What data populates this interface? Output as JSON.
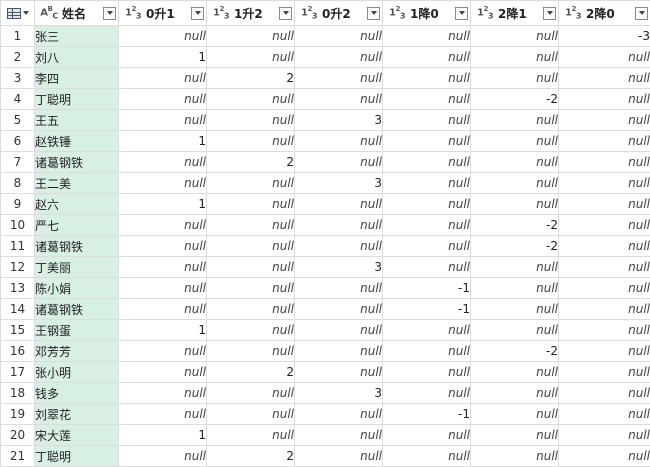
{
  "columns": [
    {
      "type": "ABC",
      "label": "姓名"
    },
    {
      "type": "123",
      "label": "0升1"
    },
    {
      "type": "123",
      "label": "1升2"
    },
    {
      "type": "123",
      "label": "0升2"
    },
    {
      "type": "123",
      "label": "1降0"
    },
    {
      "type": "123",
      "label": "2降1"
    },
    {
      "type": "123",
      "label": "2降0"
    }
  ],
  "rows": [
    {
      "idx": "1",
      "name": "张三",
      "values": [
        "null",
        "null",
        "null",
        "null",
        "null",
        "-3"
      ]
    },
    {
      "idx": "2",
      "name": "刘八",
      "values": [
        "1",
        "null",
        "null",
        "null",
        "null",
        "null"
      ]
    },
    {
      "idx": "3",
      "name": "李四",
      "values": [
        "null",
        "2",
        "null",
        "null",
        "null",
        "null"
      ]
    },
    {
      "idx": "4",
      "name": "丁聪明",
      "values": [
        "null",
        "null",
        "null",
        "null",
        "-2",
        "null"
      ]
    },
    {
      "idx": "5",
      "name": "王五",
      "values": [
        "null",
        "null",
        "3",
        "null",
        "null",
        "null"
      ]
    },
    {
      "idx": "6",
      "name": "赵铁锤",
      "values": [
        "1",
        "null",
        "null",
        "null",
        "null",
        "null"
      ]
    },
    {
      "idx": "7",
      "name": "诸葛钢铁",
      "values": [
        "null",
        "2",
        "null",
        "null",
        "null",
        "null"
      ]
    },
    {
      "idx": "8",
      "name": "王二美",
      "values": [
        "null",
        "null",
        "3",
        "null",
        "null",
        "null"
      ]
    },
    {
      "idx": "9",
      "name": "赵六",
      "values": [
        "1",
        "null",
        "null",
        "null",
        "null",
        "null"
      ]
    },
    {
      "idx": "10",
      "name": "严七",
      "values": [
        "null",
        "null",
        "null",
        "null",
        "-2",
        "null"
      ]
    },
    {
      "idx": "11",
      "name": "诸葛钢铁",
      "values": [
        "null",
        "null",
        "null",
        "null",
        "-2",
        "null"
      ]
    },
    {
      "idx": "12",
      "name": "丁美丽",
      "values": [
        "null",
        "null",
        "3",
        "null",
        "null",
        "null"
      ]
    },
    {
      "idx": "13",
      "name": "陈小娟",
      "values": [
        "null",
        "null",
        "null",
        "-1",
        "null",
        "null"
      ]
    },
    {
      "idx": "14",
      "name": "诸葛钢铁",
      "values": [
        "null",
        "null",
        "null",
        "-1",
        "null",
        "null"
      ]
    },
    {
      "idx": "15",
      "name": "王钢蛋",
      "values": [
        "1",
        "null",
        "null",
        "null",
        "null",
        "null"
      ]
    },
    {
      "idx": "16",
      "name": "邓芳芳",
      "values": [
        "null",
        "null",
        "null",
        "null",
        "-2",
        "null"
      ]
    },
    {
      "idx": "17",
      "name": "张小明",
      "values": [
        "null",
        "2",
        "null",
        "null",
        "null",
        "null"
      ]
    },
    {
      "idx": "18",
      "name": "钱多",
      "values": [
        "null",
        "null",
        "3",
        "null",
        "null",
        "null"
      ]
    },
    {
      "idx": "19",
      "name": "刘翠花",
      "values": [
        "null",
        "null",
        "null",
        "-1",
        "null",
        "null"
      ]
    },
    {
      "idx": "20",
      "name": "宋大莲",
      "values": [
        "1",
        "null",
        "null",
        "null",
        "null",
        "null"
      ]
    },
    {
      "idx": "21",
      "name": "丁聪明",
      "values": [
        "null",
        "2",
        "null",
        "null",
        "null",
        "null"
      ]
    }
  ]
}
